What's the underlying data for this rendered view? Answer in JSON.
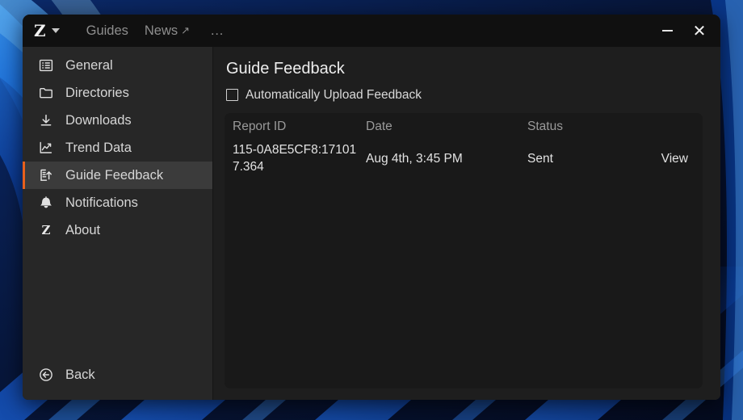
{
  "titlebar": {
    "logo_glyph": "Z",
    "logo_name": "zotero-logo",
    "menu_items": [
      {
        "label": "Guides",
        "name": "guides",
        "external": false
      },
      {
        "label": "News",
        "name": "news",
        "external": true,
        "external_glyph": "↗"
      }
    ],
    "overflow_label": "…",
    "minimize_label": "",
    "close_label": "✕"
  },
  "sidebar": {
    "items": [
      {
        "label": "General",
        "icon": "list-icon",
        "selected": false
      },
      {
        "label": "Directories",
        "icon": "folder-icon",
        "selected": false
      },
      {
        "label": "Downloads",
        "icon": "download-icon",
        "selected": false
      },
      {
        "label": "Trend Data",
        "icon": "line-chart-icon",
        "selected": false
      },
      {
        "label": "Guide Feedback",
        "icon": "document-upload-icon",
        "selected": true
      },
      {
        "label": "Notifications",
        "icon": "bell-icon",
        "selected": false
      },
      {
        "label": "About",
        "icon": "z-brand-icon",
        "selected": false
      }
    ],
    "back": {
      "label": "Back",
      "icon": "circle-arrow-left-icon"
    },
    "accent_color": "#e8601c",
    "selected_bg": "#3b3b3b"
  },
  "main": {
    "title": "Guide Feedback",
    "auto_upload": {
      "label": "Automatically Upload Feedback",
      "checked": false
    },
    "table": {
      "columns": [
        {
          "key": "report_id",
          "label": "Report ID"
        },
        {
          "key": "date",
          "label": "Date"
        },
        {
          "key": "status",
          "label": "Status"
        },
        {
          "key": "action",
          "label": ""
        }
      ],
      "rows": [
        {
          "report_id": "115-0A8E5CF8:171017.364",
          "date": "Aug 4th, 3:45 PM",
          "status": "Sent",
          "action": "View"
        }
      ],
      "status_color": "#1fd71f",
      "action_color": "#e8601c"
    }
  }
}
